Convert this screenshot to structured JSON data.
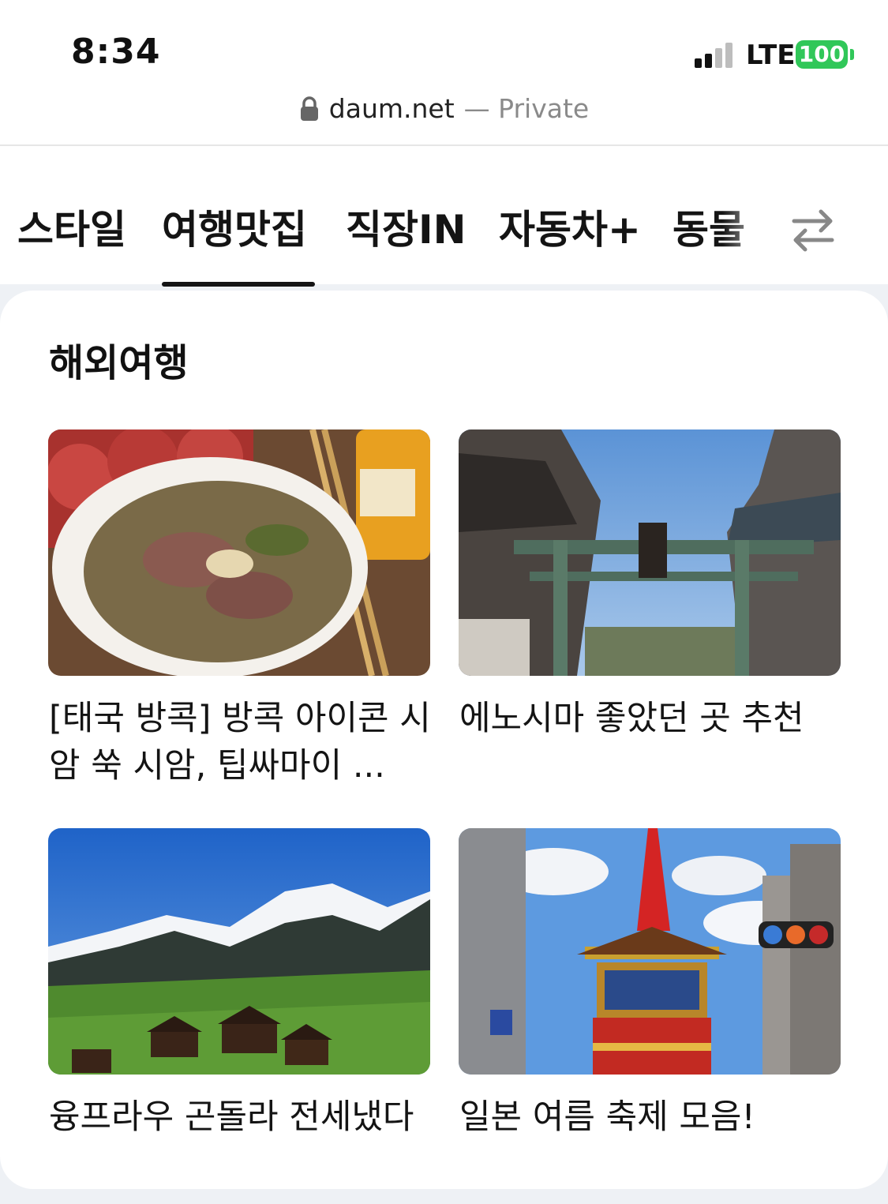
{
  "status_bar": {
    "time": "8:34",
    "network": "LTE",
    "battery": "100",
    "battery_color": "#31c759"
  },
  "url_bar": {
    "icon": "lock-icon",
    "domain": "daum.net",
    "privacy": "— Private"
  },
  "tabs": {
    "items": [
      {
        "label": "스타일"
      },
      {
        "label": "여행맛집"
      },
      {
        "label": "직장IN"
      },
      {
        "label": "자동차+"
      },
      {
        "label": "동물"
      }
    ],
    "active": "여행맛집",
    "more_icon": "swap-arrows-icon"
  },
  "section": {
    "title": "해외여행",
    "articles": [
      {
        "title": "[태국 방콕] 방콕 아이콘 시암 쑥 시암, 팁싸마이 ...",
        "image": "noodle-soup-photo"
      },
      {
        "title": "에노시마 좋았던 곳 추천",
        "image": "enoshima-torii-photo"
      },
      {
        "title": "융프라우 곤돌라 전세냈다",
        "image": "alpine-village-photo"
      },
      {
        "title": "일본 여름 축제 모음!",
        "image": "festival-float-photo"
      }
    ]
  }
}
